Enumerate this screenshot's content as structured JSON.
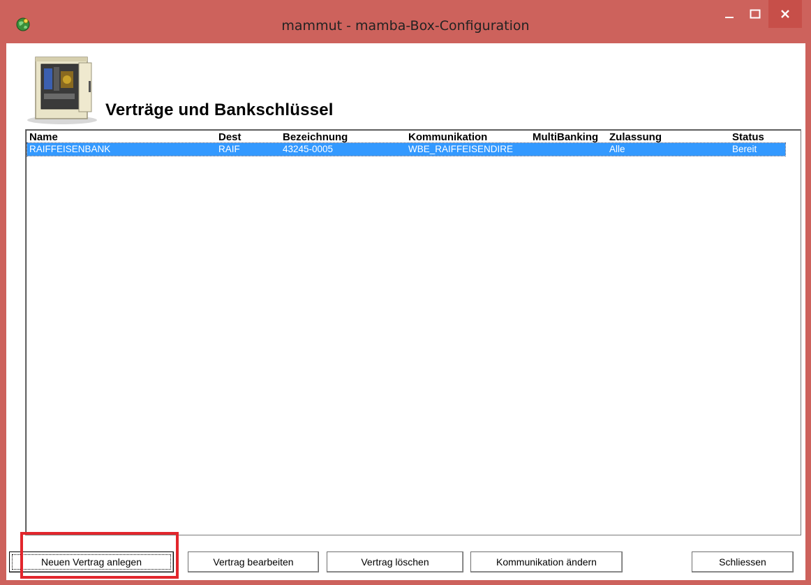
{
  "window": {
    "title": "mammut - mamba-Box-Configuration",
    "accent_color": "#cd625c"
  },
  "page": {
    "heading": "Verträge und Bankschlüssel"
  },
  "table": {
    "columns": [
      "Name",
      "Dest",
      "Bezeichnung",
      "Kommunikation",
      "MultiBanking",
      "Zulassung",
      "Status"
    ],
    "rows": [
      {
        "name": "RAIFFEISENBANK",
        "dest": "RAIF",
        "bezeichnung": "43245-0005",
        "kommunikation": "WBE_RAIFFEISENDIRE",
        "multibanking": "",
        "zulassung": "Alle",
        "status": "Bereit",
        "selected": true
      }
    ],
    "selection_color": "#3399ff"
  },
  "buttons": {
    "new": "Neuen Vertrag anlegen",
    "edit": "Vertrag bearbeiten",
    "delete": "Vertrag löschen",
    "communication": "Kommunikation ändern",
    "close": "Schliessen"
  },
  "annotation": {
    "highlight_color": "#e2262c"
  },
  "icons": {
    "app": "globe-icon",
    "illustration": "safe-icon"
  }
}
